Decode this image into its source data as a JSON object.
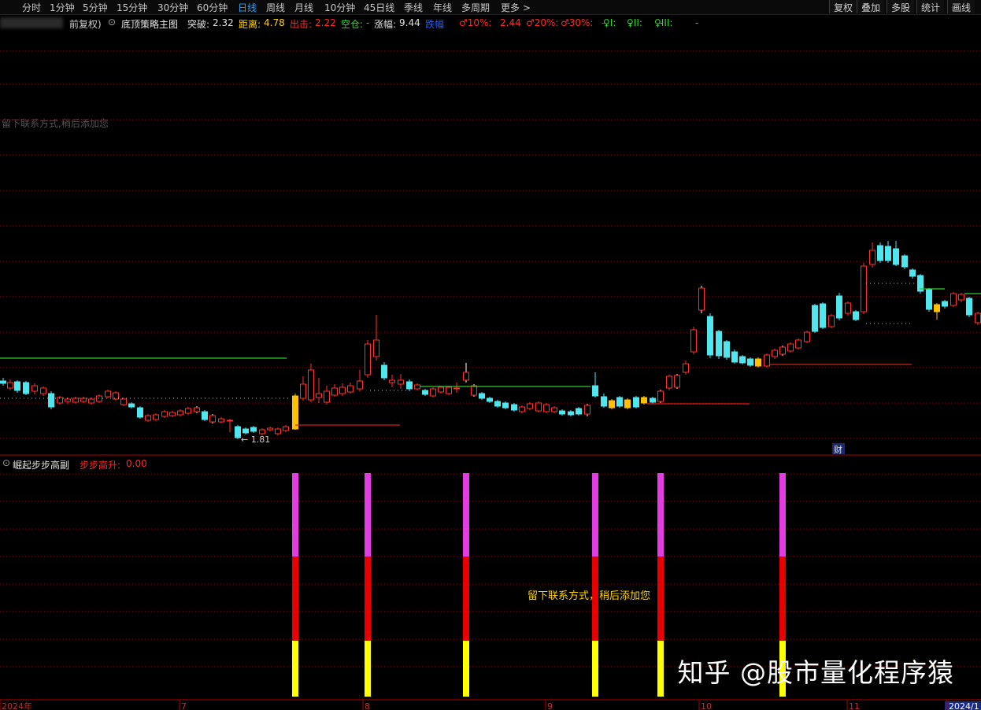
{
  "toolbar": {
    "periods": [
      "分时",
      "1分钟",
      "5分钟",
      "15分钟",
      "30分钟",
      "60分钟",
      "日线",
      "周线",
      "月线",
      "10分钟",
      "45日线",
      "季线",
      "年线",
      "多周期",
      "更多 >"
    ],
    "active": "日线",
    "right_buttons": [
      "复权",
      "叠加",
      "多股",
      "统计",
      "画线"
    ]
  },
  "main_indicator": {
    "adjust_label": "前复权)",
    "name": "底顶策略主图",
    "fields": [
      {
        "label": "突破:",
        "value": "2.32",
        "label_color": "#e0e0e0",
        "value_color": "#e0e0e0"
      },
      {
        "label": "距离:",
        "value": "4.78",
        "label_color": "#ffd400",
        "value_color": "#ffd400"
      },
      {
        "label": "出击:",
        "value": "2.22",
        "label_color": "#ff2a2a",
        "value_color": "#ff2a2a"
      },
      {
        "label": "空仓:",
        "value": "-",
        "label_color": "#2bd92b",
        "value_color": "#2bd92b"
      },
      {
        "label": "涨幅:",
        "value": "9.44",
        "label_color": "#e0e0e0",
        "value_color": "#e0e0e0"
      },
      {
        "label": "跌幅",
        "value": "",
        "label_color": "#1e5bff",
        "value_color": "#1e5bff"
      },
      {
        "label": "♂10%:",
        "value": "2.44",
        "label_color": "#ff2a2a",
        "value_color": "#ff2a2a"
      },
      {
        "label": "♂20%:",
        "value": "-",
        "label_color": "#ff2a2a",
        "value_color": "#ff2a2a"
      },
      {
        "label": "♂30%:",
        "value": "-",
        "label_color": "#ff2a2a",
        "value_color": "#ff2a2a"
      },
      {
        "label": "♀I:",
        "value": "-",
        "label_color": "#2bd92b",
        "value_color": "#2bd92b"
      },
      {
        "label": "♀II:",
        "value": "-",
        "label_color": "#2bd92b",
        "value_color": "#2bd92b"
      },
      {
        "label": "♀III:",
        "value": "-",
        "label_color": "#2bd92b",
        "value_color": "#2bd92b"
      }
    ]
  },
  "ghost_note": "留下联系方式,稍后添加您",
  "low_marker": "1.81",
  "cai_marker": "财",
  "sub_indicator": {
    "name": "崛起步步高副",
    "field_label": "步步高升:",
    "field_value": "0.00"
  },
  "sub_note": "留下联系方式，稍后添加您",
  "x_axis_labels": [
    "2024年",
    "7",
    "8",
    "9",
    "10",
    "11",
    "2024/1"
  ],
  "watermark": "知乎 @股市量化程序猿",
  "colors": {
    "up": "#ff3030",
    "down": "#4fe6ee",
    "magenta": "#e23ce2",
    "red": "#e80000",
    "yellow": "#ffff00",
    "grid": "#8a0000",
    "green": "#2ecc2e"
  }
}
